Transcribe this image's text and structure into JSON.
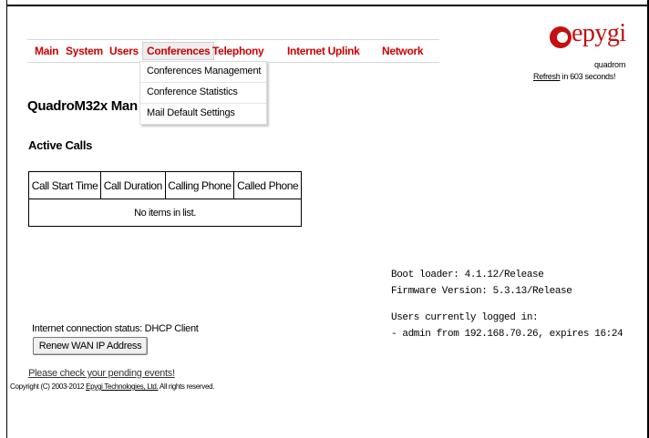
{
  "nav": {
    "items": [
      "Main",
      "System",
      "Users",
      "Conferences",
      "Telephony",
      "Internet Uplink",
      "Network"
    ],
    "active": "Conferences",
    "accent_color": "#cc0000"
  },
  "dropdown": {
    "items": [
      "Conferences Management",
      "Conference Statistics",
      "Mail Default Settings"
    ]
  },
  "branding": {
    "logo_text": "epygi",
    "product": "quadrom",
    "refresh_link": "Refresh",
    "refresh_text": " in 603 seconds!"
  },
  "page": {
    "title": "QuadroM32x Man",
    "section": "Active Calls"
  },
  "calls_table": {
    "headers": [
      "Call Start Time",
      "Call Duration",
      "Calling Phone",
      "Called Phone"
    ],
    "empty_message": "No items in list."
  },
  "system_info": {
    "boot_loader": "Boot loader: 4.1.12/Release",
    "firmware": "Firmware Version: 5.3.13/Release",
    "users_label": "Users currently logged in:",
    "user_entry": "- admin from 192.168.70.26, expires 16:24"
  },
  "wan": {
    "status": "Internet connection status: DHCP Client",
    "renew_button": "Renew WAN IP Address"
  },
  "footer": {
    "pending_link": "Please check your pending events!",
    "copyright_prefix": "Copyright (C) 2003-2012 ",
    "company_link": "Epygi Technologies, Ltd.",
    "copyright_suffix": " All rights reserved."
  }
}
